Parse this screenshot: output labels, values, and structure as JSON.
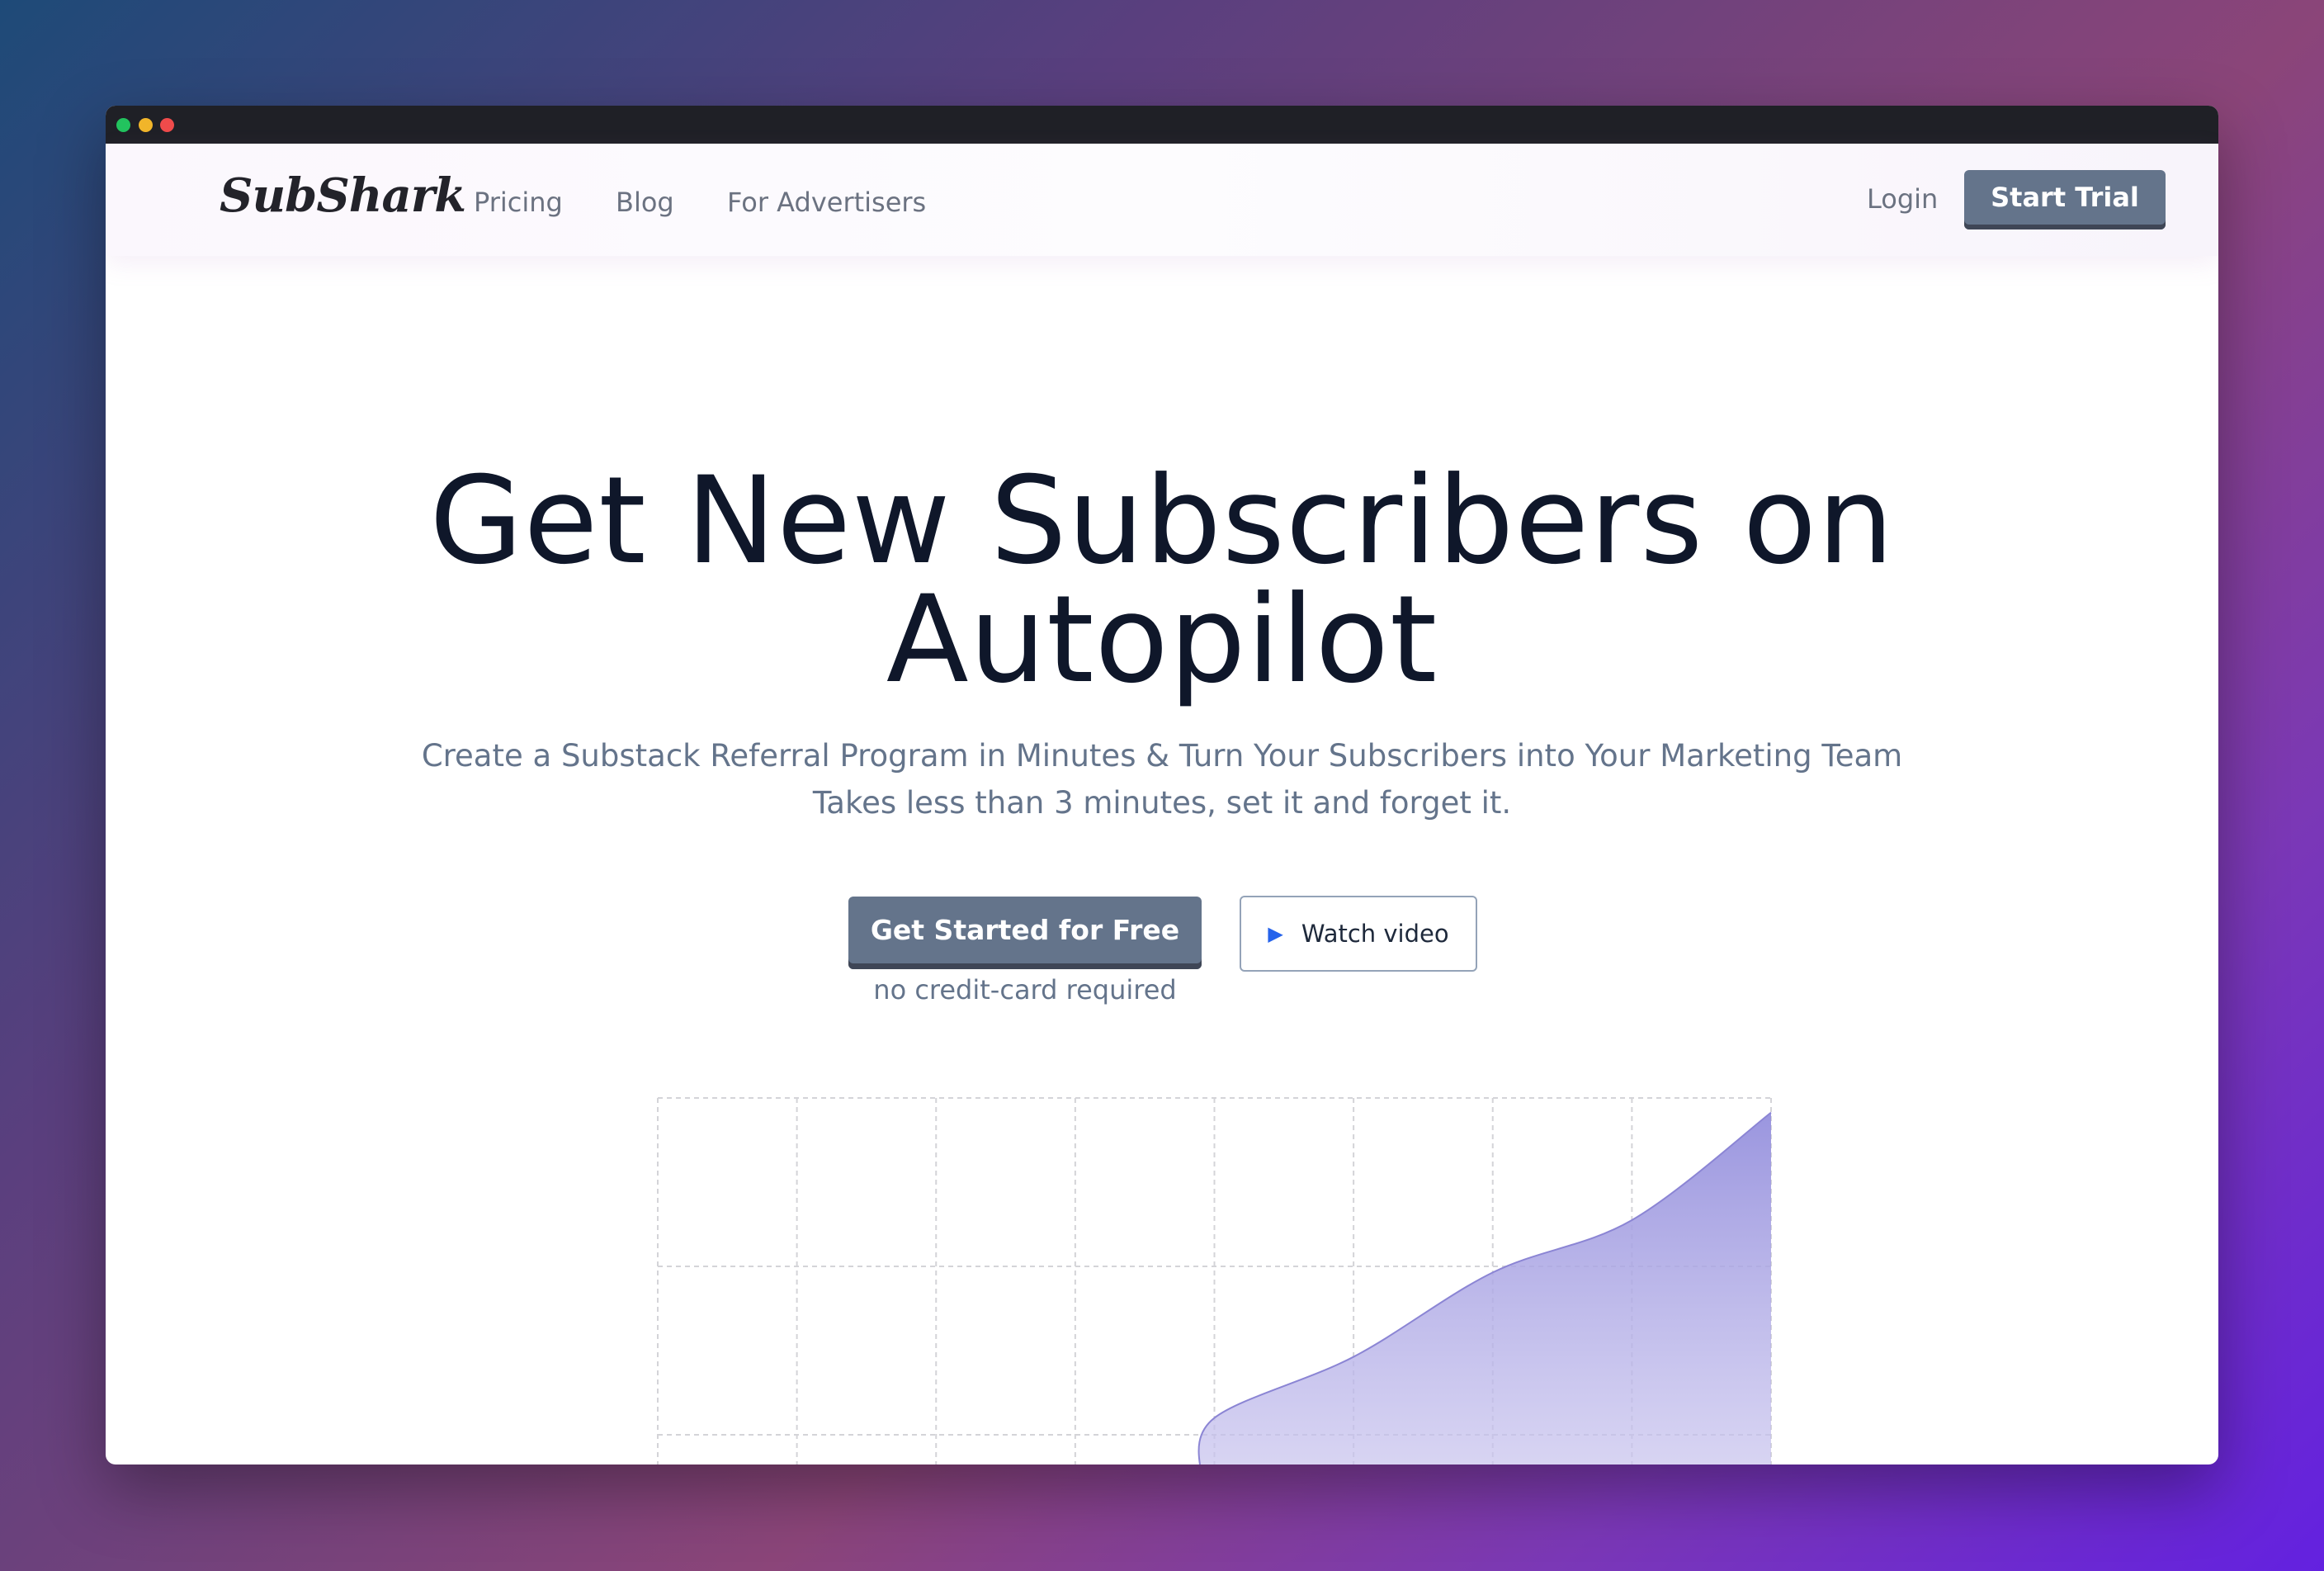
{
  "window": {
    "controls": [
      "close",
      "minimize",
      "maximize"
    ]
  },
  "nav": {
    "logo": "SubShark",
    "links": [
      "Pricing",
      "Blog",
      "For Advertisers"
    ],
    "login": "Login",
    "cta": "Start Trial"
  },
  "hero": {
    "title_line1": "Get New Subscribers on",
    "title_line2": "Autopilot",
    "subtitle1": "Create a Substack Referral Program in Minutes & Turn Your Subscribers into Your Marketing Team",
    "subtitle2": "Takes less than 3 minutes, set it and forget it.",
    "primary_cta": "Get Started for Free",
    "primary_note": "no credit-card required",
    "secondary_cta": "Watch video",
    "secondary_icon": "play-icon"
  },
  "colors": {
    "accent_button": "#64748b",
    "title": "#0f172a",
    "chart_fill": "#9d98e0",
    "play_icon": "#2563eb"
  },
  "chart_data": {
    "type": "area",
    "title": "",
    "xlabel": "",
    "ylabel": "",
    "grid": true,
    "x": [
      0,
      1,
      2,
      3,
      4,
      5,
      6,
      7,
      8
    ],
    "values": [
      null,
      null,
      null,
      null,
      0.0,
      0.42,
      1.0,
      1.36,
      2.1
    ],
    "xlim": [
      0,
      8
    ],
    "ylim": [
      -0.4,
      2.2
    ],
    "legend": "none"
  }
}
